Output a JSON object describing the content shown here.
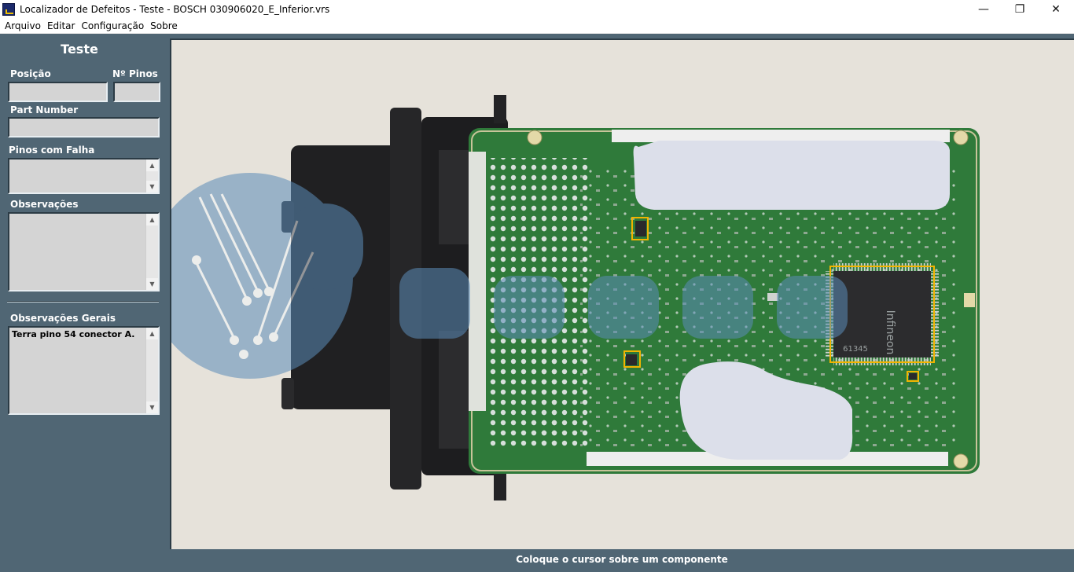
{
  "window": {
    "title": "Localizador de Defeitos - Teste - BOSCH 030906020_E_Inferior.vrs",
    "minimize": "—",
    "maximize": "❐",
    "close": "✕"
  },
  "menu": [
    "Arquivo",
    "Editar",
    "Configuração",
    "Sobre"
  ],
  "panel": {
    "title": "Teste",
    "position_label": "Posição",
    "position_value": "",
    "pins_label": "Nº Pinos",
    "pins_value": "",
    "part_number_label": "Part Number",
    "part_number_value": "",
    "failed_pins_label": "Pinos com Falha",
    "failed_pins_value": "",
    "notes_label": "Observações",
    "notes_value": "",
    "general_notes_label": "Observações Gerais",
    "general_notes_value": "Terra pino 54 conector A."
  },
  "board": {
    "chip_brand": "Infineon",
    "chip_code": "61345"
  },
  "status": "Coloque o cursor sobre um componente",
  "colors": {
    "panel_bg": "#506674",
    "pcb_green": "#2f7a3a",
    "highlight": "#f2b400",
    "connector": "#1f1f21"
  }
}
